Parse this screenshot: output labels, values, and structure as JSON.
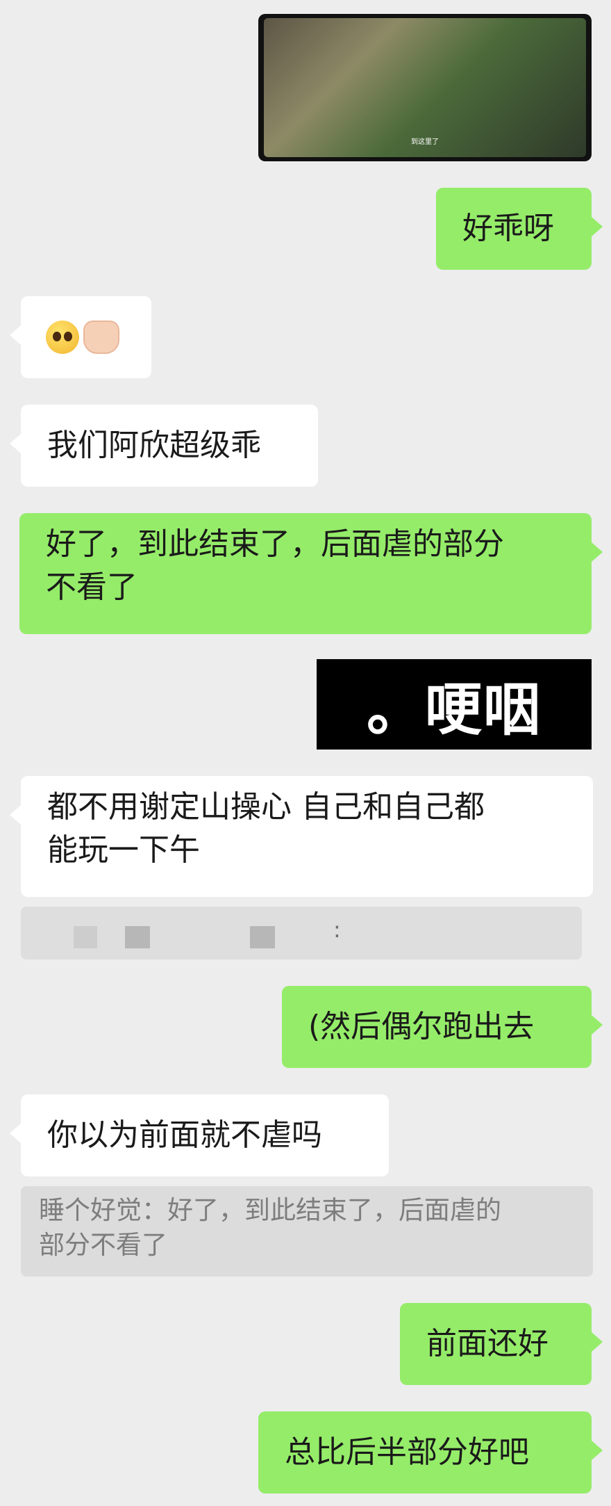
{
  "chat": {
    "video": {
      "subtitle": "到这里了"
    },
    "msg1": "好乖呀",
    "msg2_emoji": [
      "smiling-face-with-tears-emoji",
      "palms-up-together-emoji"
    ],
    "msg3": "我们阿欣超级乖",
    "msg4_line1": "好了，到此结束了，后面虐的部分",
    "msg4_line2": "不看了",
    "sticker": "。哽咽",
    "msg5_line1": "都不用谢定山操心  自己和自己都",
    "msg5_line2": "能玩一下午",
    "blurred_quote_sep": ":",
    "msg6": "(然后偶尔跑出去",
    "msg7": "你以为前面就不虐吗",
    "quote2_line1": "睡个好觉：好了，到此结束了，后面虐的",
    "quote2_line2": "部分不看了",
    "msg8": "前面还好",
    "msg9": "总比后半部分好吧"
  },
  "colors": {
    "background": "#ededed",
    "incoming_bubble": "#ffffff",
    "outgoing_bubble": "#95ec69",
    "quote_bg": "#dcdcdc"
  }
}
